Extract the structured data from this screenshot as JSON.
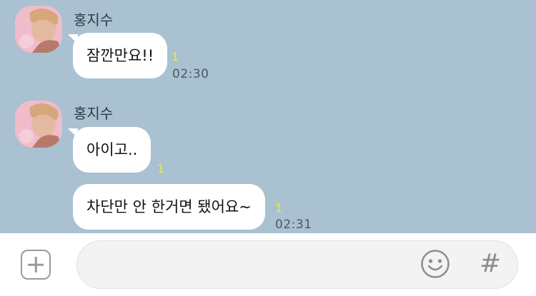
{
  "chat": {
    "messages": [
      {
        "sender": "홍지수",
        "text": "잠깐만요!!",
        "unread": "1",
        "time": "02:30"
      },
      {
        "sender": "홍지수",
        "text": "아이고..",
        "unread": "1"
      },
      {
        "text": "차단만 안 한거면 됐어요~",
        "unread": "1",
        "time": "02:31"
      }
    ]
  },
  "input_bar": {
    "placeholder": "",
    "plus_icon": "plus-square-icon",
    "emoji_icon": "smiley-icon",
    "hash_label": "#"
  },
  "colors": {
    "chat_background": "#a9c1d1",
    "bubble": "#ffffff",
    "unread_count": "#f5e82c",
    "input_bar": "#ffffff"
  }
}
